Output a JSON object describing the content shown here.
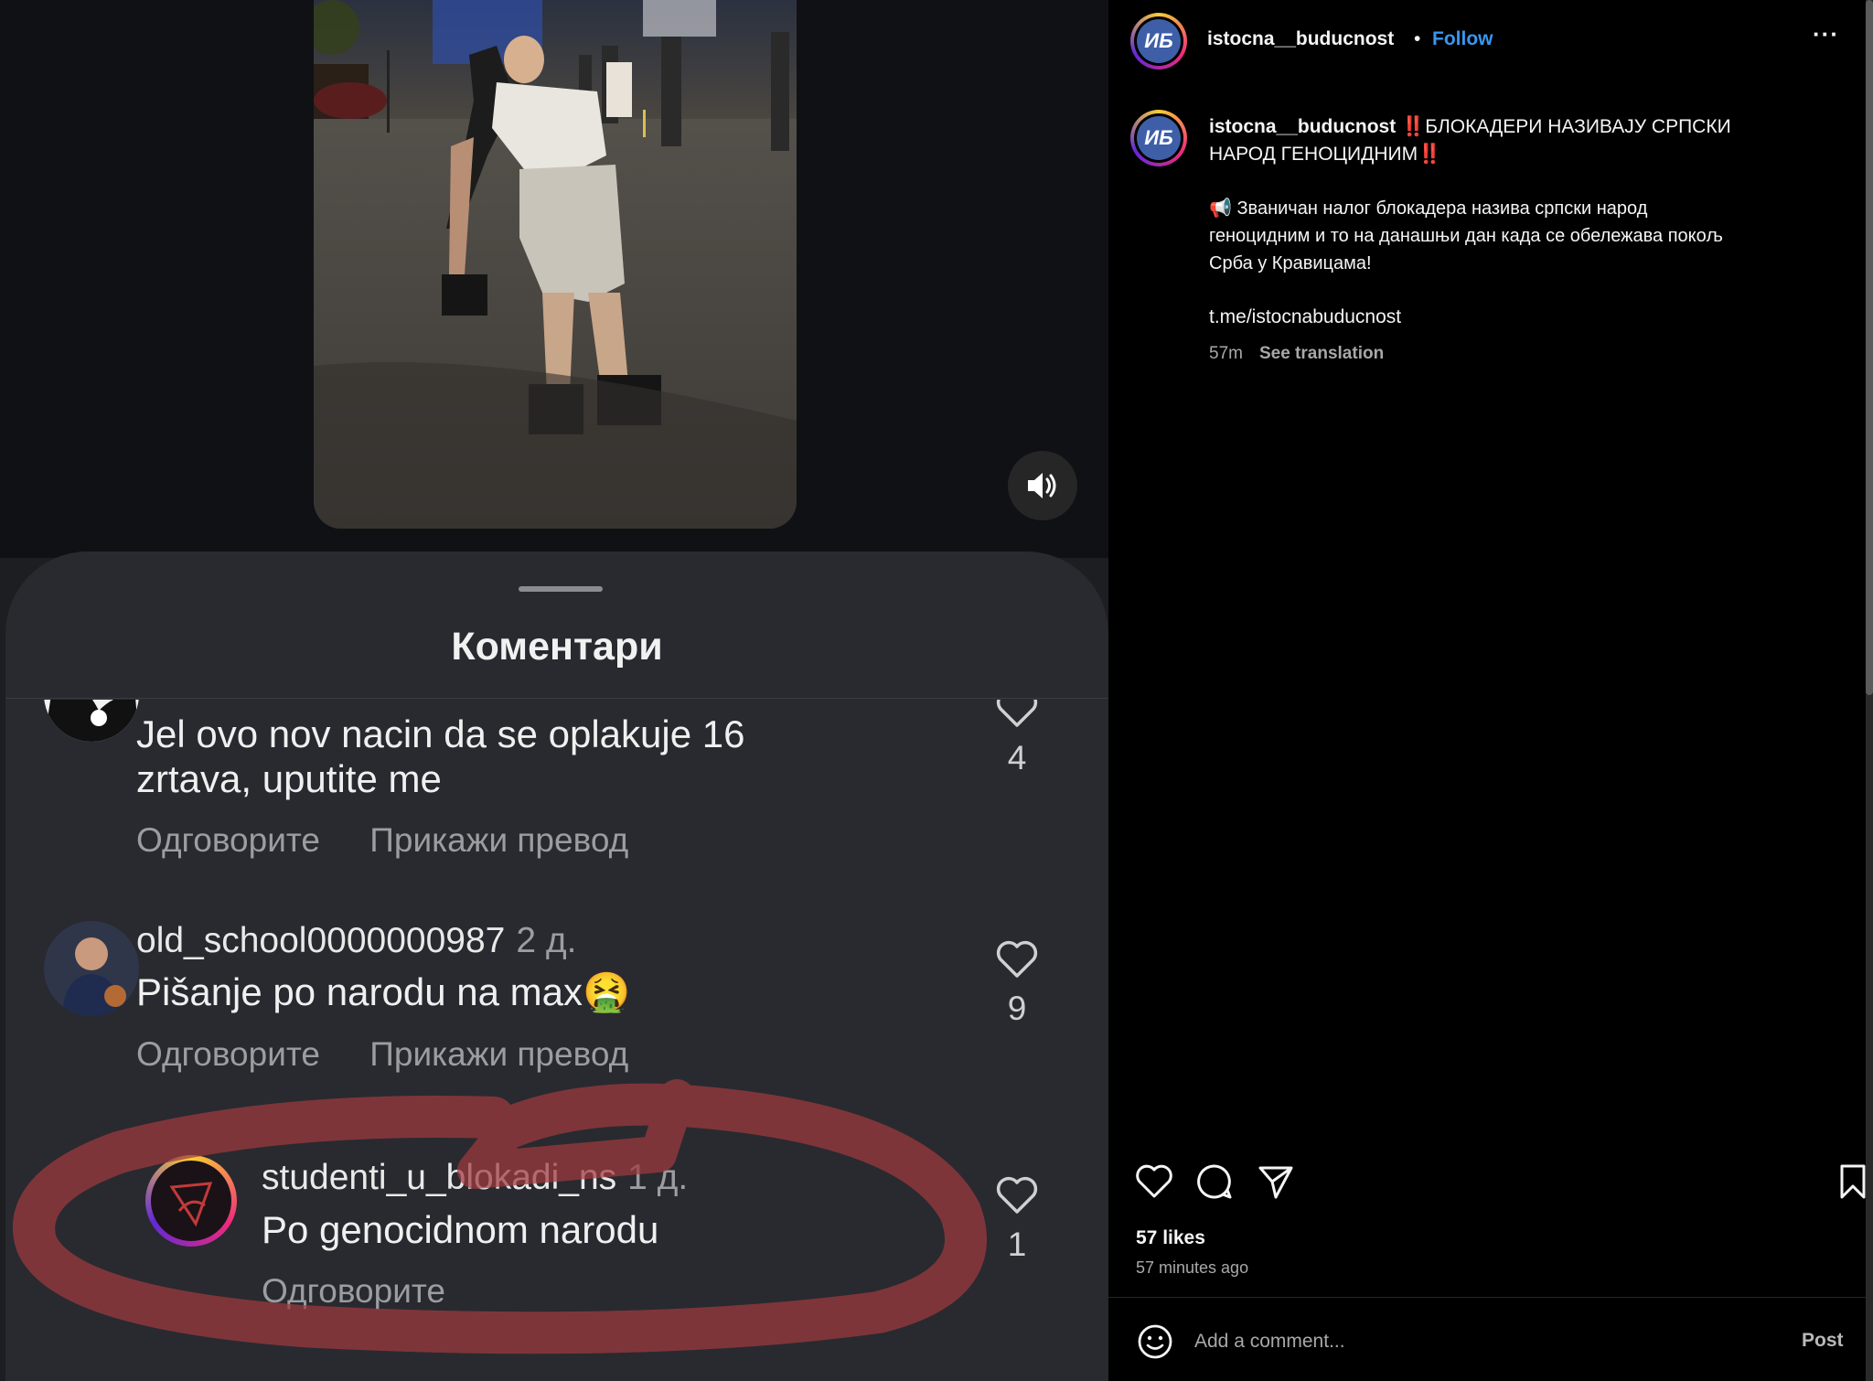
{
  "left_panel": {
    "sheet_title": "Коментари",
    "comments": [
      {
        "username": "",
        "time": "",
        "text_lines": [
          "Jel ovo nov nacin da se oplakuje 16",
          "zrtava, uputite me"
        ],
        "actions": [
          "Одговорите",
          "Прикажи превод"
        ],
        "likes": "4"
      },
      {
        "username": "old_school0000000987",
        "time": "2 д.",
        "text_lines": [
          "Pišanje po narodu na max🤮"
        ],
        "actions": [
          "Одговорите",
          "Прикажи превод"
        ],
        "likes": "9"
      },
      {
        "username": "studenti_u_blokadi_ns",
        "time": "1 д.",
        "text_lines": [
          "Po genocidnom narodu"
        ],
        "actions": [
          "Одговорите"
        ],
        "likes": "1"
      }
    ],
    "highlight_color": "#a03a3f"
  },
  "post": {
    "avatar_initials": "ИБ",
    "username": "istocna__buducnost",
    "dot": "•",
    "follow_label": "Follow",
    "more_label": "···",
    "caption": {
      "username": "istocna__buducnost",
      "headline_line1": "‼️БЛОКАДЕРИ НАЗИВАЈУ СРПСКИ",
      "headline_line2": "НАРОД ГЕНОЦИДНИМ‼️",
      "body_line1": "📢 Званичан налог блокадера назива српски народ",
      "body_line2": "геноцидним и то на данашњи дан када се обележава покољ",
      "body_line3": "Срба у Кравицама!",
      "link": "t.me/istocnabuducnost",
      "age": "57m",
      "see_translation": "See translation"
    },
    "likes": "57 likes",
    "time_ago": "57 minutes ago",
    "comment_placeholder": "Add a comment...",
    "post_label": "Post",
    "icons": [
      "heart-icon",
      "comment-icon",
      "share-icon",
      "bookmark-icon",
      "emoji-icon",
      "volume-icon"
    ],
    "colors": {
      "link": "#3897f0",
      "background": "#000000",
      "sheet": "#282a2f"
    }
  }
}
